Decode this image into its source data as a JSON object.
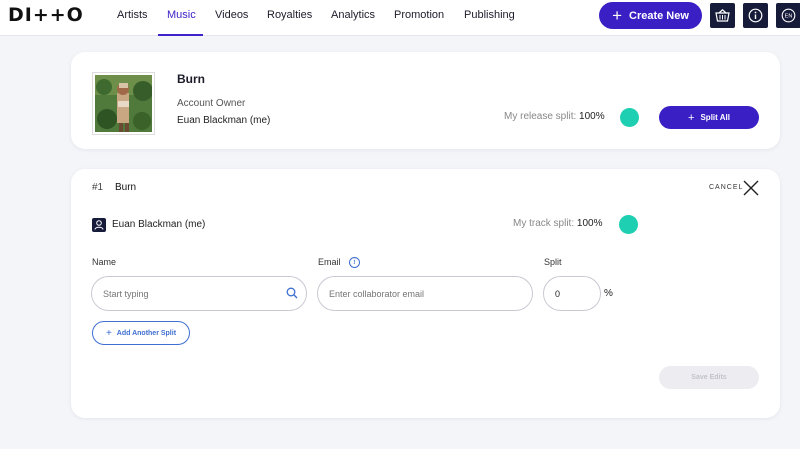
{
  "brand": {
    "logo_text": "DI++O",
    "accent": "#3a1fc4",
    "dark": "#171b3a",
    "teal": "#1ecfb1"
  },
  "nav": {
    "items": [
      {
        "label": "Artists",
        "active": false
      },
      {
        "label": "Music",
        "active": true
      },
      {
        "label": "Videos",
        "active": false
      },
      {
        "label": "Royalties",
        "active": false
      },
      {
        "label": "Analytics",
        "active": false
      },
      {
        "label": "Promotion",
        "active": false
      },
      {
        "label": "Publishing",
        "active": false
      }
    ],
    "create_label": "Create New",
    "icons": [
      "basket-icon",
      "info-icon",
      "language-icon"
    ],
    "language": "EN"
  },
  "release": {
    "title": "Burn",
    "owner_label": "Account Owner",
    "owner_name": "Euan Blackman (me)",
    "split_label": "My release split:",
    "split_value": "100%",
    "split_all_label": "Split All"
  },
  "track": {
    "number": "#1",
    "title": "Burn",
    "cancel_label": "CANCEL",
    "user_name": "Euan Blackman (me)",
    "split_label": "My track split:",
    "split_value": "100%",
    "fields": {
      "name_label": "Name",
      "name_placeholder": "Start typing",
      "email_label": "Email",
      "email_placeholder": "Enter collaborator email",
      "split_label": "Split",
      "split_value": "0",
      "split_unit": "%"
    },
    "add_split_label": "Add Another Split",
    "save_label": "Save Edits"
  }
}
